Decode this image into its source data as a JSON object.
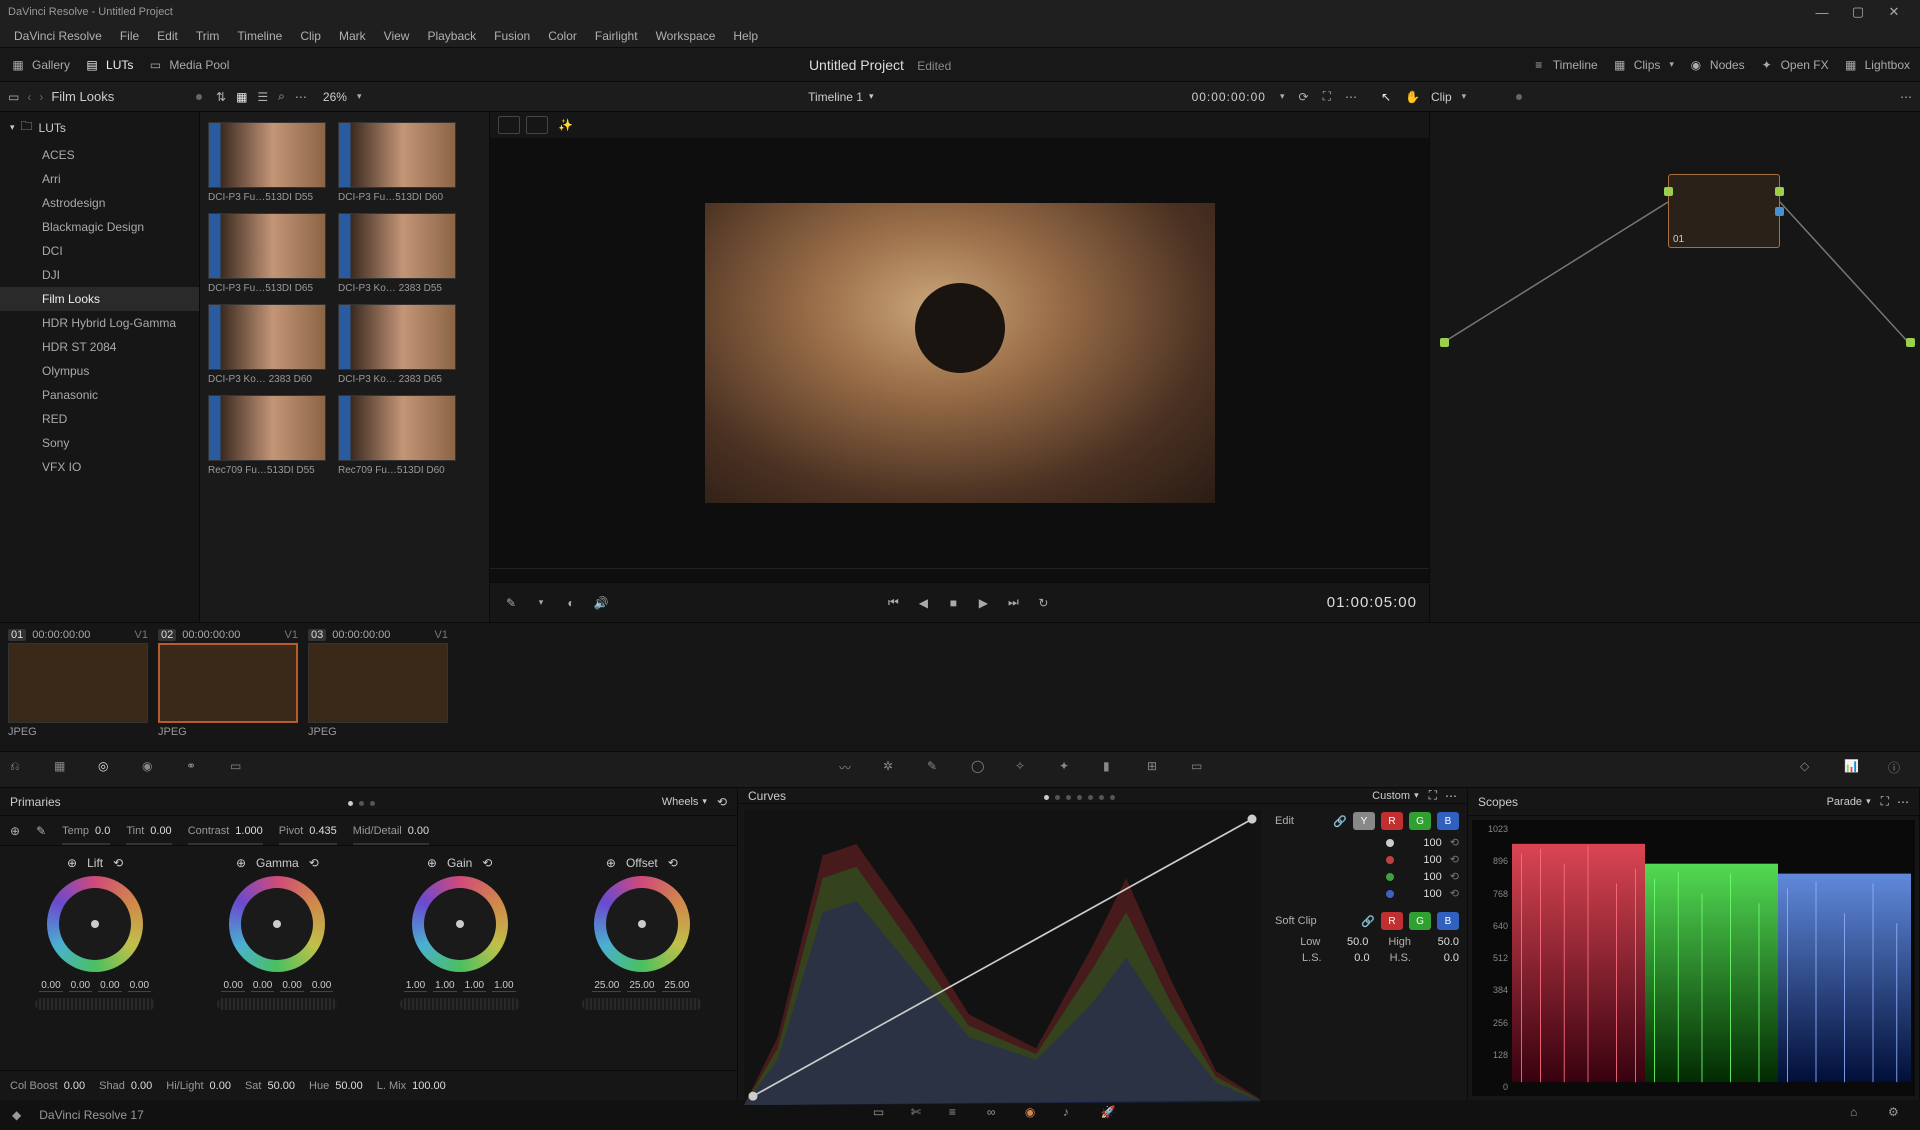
{
  "app": {
    "title": "DaVinci Resolve - Untitled Project"
  },
  "menu": [
    "DaVinci Resolve",
    "File",
    "Edit",
    "Trim",
    "Timeline",
    "Clip",
    "Mark",
    "View",
    "Playback",
    "Fusion",
    "Color",
    "Fairlight",
    "Workspace",
    "Help"
  ],
  "toolbar": {
    "gallery": "Gallery",
    "luts": "LUTs",
    "mediapool": "Media Pool",
    "project": "Untitled Project",
    "edited": "Edited",
    "timeline_btn": "Timeline",
    "clips_btn": "Clips",
    "nodes_btn": "Nodes",
    "openfx": "Open FX",
    "lightbox": "Lightbox"
  },
  "second": {
    "breadcrumb": "Film Looks",
    "zoom": "26%",
    "timeline_name": "Timeline 1",
    "timecode": "00:00:00:00",
    "node_mode": "Clip"
  },
  "sidebar": {
    "root": "LUTs",
    "items": [
      "ACES",
      "Arri",
      "Astrodesign",
      "Blackmagic Design",
      "DCI",
      "DJI",
      "Film Looks",
      "HDR Hybrid Log-Gamma",
      "HDR ST 2084",
      "Olympus",
      "Panasonic",
      "RED",
      "Sony",
      "VFX IO"
    ],
    "selected": 6
  },
  "luts": [
    "DCI-P3 Fu…513DI D55",
    "DCI-P3 Fu…513DI D60",
    "DCI-P3 Fu…513DI D65",
    "DCI-P3 Ko… 2383 D55",
    "DCI-P3 Ko… 2383 D60",
    "DCI-P3 Ko… 2383 D65",
    "Rec709 Fu…513DI D55",
    "Rec709 Fu…513DI D60"
  ],
  "viewer": {
    "tc_out": "01:00:05:00"
  },
  "node": {
    "label": "01"
  },
  "clips": [
    {
      "no": "01",
      "tc": "00:00:00:00",
      "trk": "V1",
      "fmt": "JPEG"
    },
    {
      "no": "02",
      "tc": "00:00:00:00",
      "trk": "V1",
      "fmt": "JPEG"
    },
    {
      "no": "03",
      "tc": "00:00:00:00",
      "trk": "V1",
      "fmt": "JPEG"
    }
  ],
  "clip_selected": 1,
  "primaries": {
    "title": "Primaries",
    "mode": "Wheels",
    "temp_l": "Temp",
    "temp_v": "0.0",
    "tint_l": "Tint",
    "tint_v": "0.00",
    "contrast_l": "Contrast",
    "contrast_v": "1.000",
    "pivot_l": "Pivot",
    "pivot_v": "0.435",
    "mid_l": "Mid/Detail",
    "mid_v": "0.00",
    "wheels": [
      {
        "name": "Lift",
        "vals": [
          "0.00",
          "0.00",
          "0.00",
          "0.00"
        ]
      },
      {
        "name": "Gamma",
        "vals": [
          "0.00",
          "0.00",
          "0.00",
          "0.00"
        ]
      },
      {
        "name": "Gain",
        "vals": [
          "1.00",
          "1.00",
          "1.00",
          "1.00"
        ]
      },
      {
        "name": "Offset",
        "vals": [
          "25.00",
          "25.00",
          "25.00"
        ]
      }
    ],
    "colboost_l": "Col Boost",
    "colboost_v": "0.00",
    "shad_l": "Shad",
    "shad_v": "0.00",
    "hilight_l": "Hi/Light",
    "hilight_v": "0.00",
    "sat_l": "Sat",
    "sat_v": "50.00",
    "hue_l": "Hue",
    "hue_v": "50.00",
    "lmix_l": "L. Mix",
    "lmix_v": "100.00"
  },
  "curves": {
    "title": "Curves",
    "mode": "Custom",
    "edit_l": "Edit",
    "vals": [
      "100",
      "100",
      "100",
      "100"
    ],
    "softclip_l": "Soft Clip",
    "low_l": "Low",
    "low_v": "50.0",
    "high_l": "High",
    "high_v": "50.0",
    "ls_l": "L.S.",
    "ls_v": "0.0",
    "hs_l": "H.S.",
    "hs_v": "0.0"
  },
  "scopes": {
    "title": "Scopes",
    "mode": "Parade",
    "ticks": [
      "1023",
      "896",
      "768",
      "640",
      "512",
      "384",
      "256",
      "128",
      "0"
    ]
  },
  "pagebar": {
    "app": "DaVinci Resolve 17"
  }
}
